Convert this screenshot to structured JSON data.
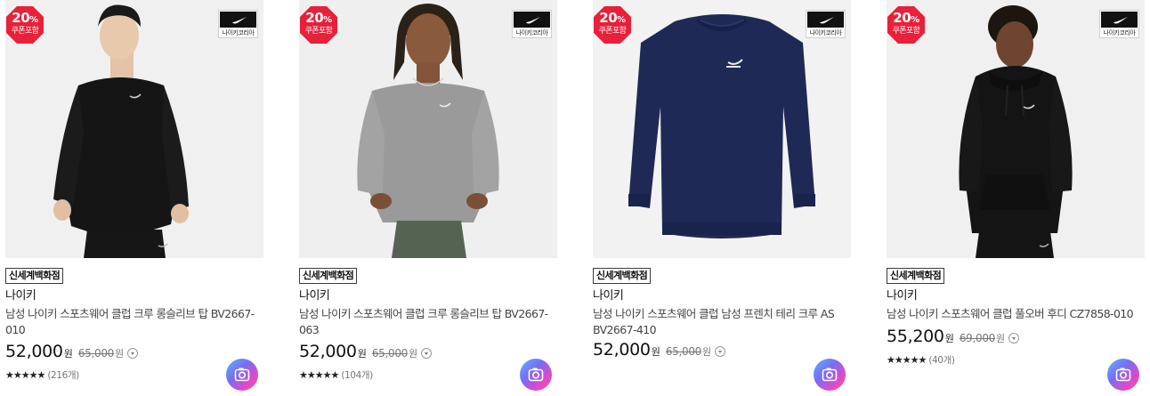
{
  "colors": {
    "badge_red": "#e8203a",
    "text": "#222222",
    "muted": "#777777"
  },
  "products": [
    {
      "coupon_percent": "20",
      "coupon_unit": "%",
      "coupon_label": "쿠폰포함",
      "brand_logo_label": "나이키코리아",
      "store_tag": "신세계백화점",
      "brand": "나이키",
      "name": "남성 나이키 스포츠웨어 클럽 크루 롱슬리브 탑 BV2667-010",
      "price": "52,000",
      "price_unit": "원",
      "original_price": "65,000",
      "original_unit": "원",
      "rating_stars": "★★★★★",
      "review_count": "(216개)",
      "image_icon": "product-photo-black-crew-sweatshirt"
    },
    {
      "coupon_percent": "20",
      "coupon_unit": "%",
      "coupon_label": "쿠폰포함",
      "brand_logo_label": "나이키코리아",
      "store_tag": "신세계백화점",
      "brand": "나이키",
      "name": "남성 나이키 스포츠웨어 클럽 크루 롱슬리브 탑 BV2667-063",
      "price": "52,000",
      "price_unit": "원",
      "original_price": "65,000",
      "original_unit": "원",
      "rating_stars": "★★★★★",
      "review_count": "(104개)",
      "image_icon": "product-photo-grey-crew-sweatshirt"
    },
    {
      "coupon_percent": "20",
      "coupon_unit": "%",
      "coupon_label": "쿠폰포함",
      "brand_logo_label": "나이키코리아",
      "store_tag": "신세계백화점",
      "brand": "나이키",
      "name": "남성 나이키 스포츠웨어 클럽 남성 프렌치 테리 크루 AS BV2667-410",
      "price": "52,000",
      "price_unit": "원",
      "original_price": "65,000",
      "original_unit": "원",
      "rating_stars": "",
      "review_count": "",
      "image_icon": "product-photo-navy-crew-sweatshirt"
    },
    {
      "coupon_percent": "20",
      "coupon_unit": "%",
      "coupon_label": "쿠폰포함",
      "brand_logo_label": "나이키코리아",
      "store_tag": "신세계백화점",
      "brand": "나이키",
      "name": "남성 나이키 스포츠웨어 클럽 풀오버 후디 CZ7858-010",
      "price": "55,200",
      "price_unit": "원",
      "original_price": "69,000",
      "original_unit": "원",
      "rating_stars": "★★★★★",
      "review_count": "(40개)",
      "image_icon": "product-photo-black-hoodie"
    }
  ]
}
